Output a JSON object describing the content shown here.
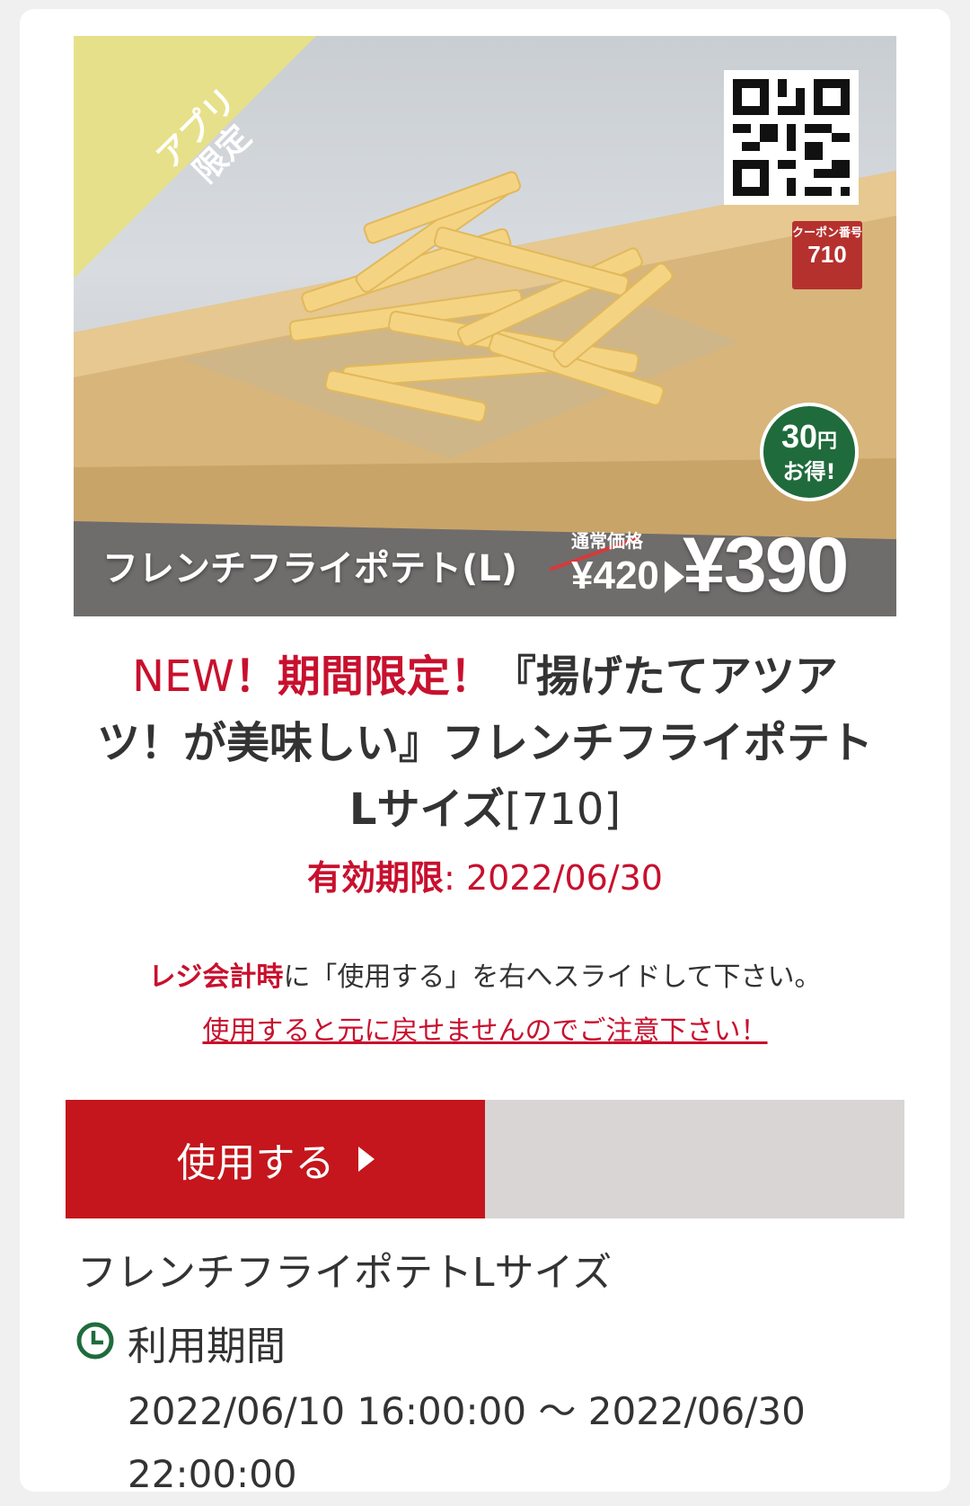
{
  "coupon": {
    "badge_ribbon": "アプリ限定",
    "coupon_number_label": "クーポン番号",
    "coupon_number": "710",
    "savings_amount": "30",
    "savings_unit": "円",
    "savings_text": "お得!",
    "product_overlay_name": "フレンチフライポテト(L)",
    "regular_price_label": "通常価格",
    "regular_price": "¥420",
    "sale_price": "¥390"
  },
  "headline": {
    "new": "NEW",
    "limited": "！期間限定！",
    "title": "『揚げたてアツアツ！が美味しい』フレンチフライポテトLサイズ",
    "code": "[710]"
  },
  "expiry": {
    "label": "有効期限",
    "sep": ":",
    "date": "2022/06/30"
  },
  "instruction": {
    "bold_part": "レジ会計時",
    "rest": "に「使用する」を右へスライドして下さい。"
  },
  "warning": "使用すると元に戻せませんのでご注意下さい！",
  "slider": {
    "label": "使用する",
    "progress": 0.5,
    "colors": {
      "handle": "#c4161c",
      "track": "#d9d5d4"
    }
  },
  "details": {
    "name": "フレンチフライポテトLサイズ",
    "period_label": "利用期間",
    "period_value": "2022/06/10 16:00:00 〜 2022/06/30 22:00:00",
    "period_icon": "clock-icon"
  }
}
